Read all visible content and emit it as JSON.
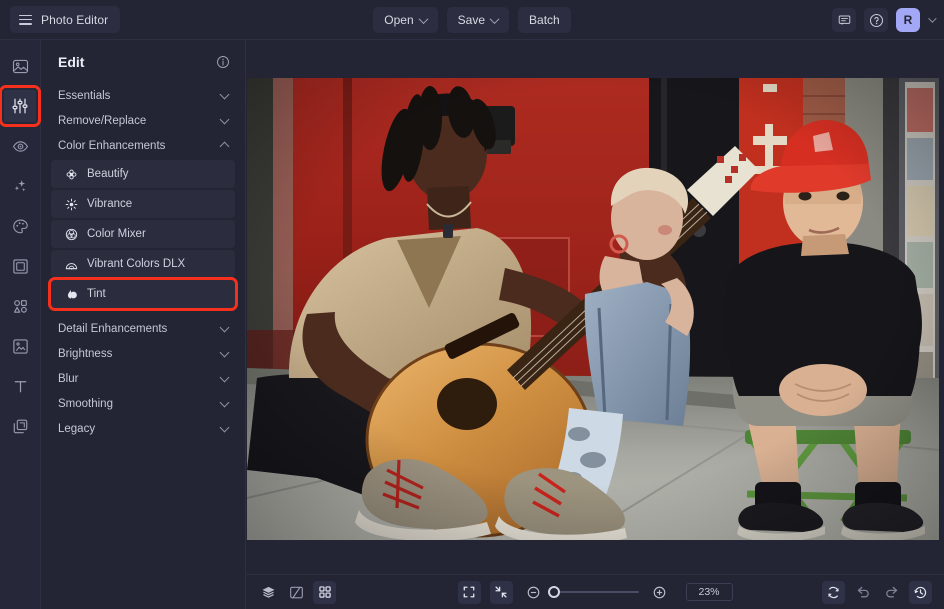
{
  "app": {
    "title": "Photo Editor",
    "menu_icon": "hamburger-icon"
  },
  "topbar": {
    "open_label": "Open",
    "save_label": "Save",
    "batch_label": "Batch",
    "feedback_icon": "comment-icon",
    "help_icon": "help-circle-icon",
    "avatar_initial": "R"
  },
  "rail": {
    "items": [
      {
        "name": "image-tool",
        "icon": "image-icon",
        "active": false,
        "highlighted": false
      },
      {
        "name": "adjust-tool",
        "icon": "sliders-icon",
        "active": true,
        "highlighted": true
      },
      {
        "name": "retouch-tool",
        "icon": "eye-icon",
        "active": false,
        "highlighted": false
      },
      {
        "name": "effects-tool",
        "icon": "sparkles-icon",
        "active": false,
        "highlighted": false
      },
      {
        "name": "paint-tool",
        "icon": "palette-icon",
        "active": false,
        "highlighted": false
      },
      {
        "name": "frame-tool",
        "icon": "frame-icon",
        "active": false,
        "highlighted": false
      },
      {
        "name": "shapes-tool",
        "icon": "shapes-icon",
        "active": false,
        "highlighted": false
      },
      {
        "name": "crop-tool",
        "icon": "crop-frame-icon",
        "active": false,
        "highlighted": false
      },
      {
        "name": "text-tool",
        "icon": "text-icon",
        "active": false,
        "highlighted": false
      },
      {
        "name": "layers-tool",
        "icon": "layers-stack-icon",
        "active": false,
        "highlighted": false
      }
    ]
  },
  "panel": {
    "title": "Edit",
    "info_icon": "info-circle-icon",
    "groups": [
      {
        "label": "Essentials",
        "expanded": false
      },
      {
        "label": "Remove/Replace",
        "expanded": false
      },
      {
        "label": "Color Enhancements",
        "expanded": true
      },
      {
        "label": "Detail Enhancements",
        "expanded": false
      },
      {
        "label": "Brightness",
        "expanded": false
      },
      {
        "label": "Blur",
        "expanded": false
      },
      {
        "label": "Smoothing",
        "expanded": false
      },
      {
        "label": "Legacy",
        "expanded": false
      }
    ],
    "color_enhancement_items": [
      {
        "label": "Beautify",
        "icon": "flower-icon",
        "highlighted": false
      },
      {
        "label": "Vibrance",
        "icon": "sun-burst-icon",
        "highlighted": false
      },
      {
        "label": "Color Mixer",
        "icon": "color-circles-icon",
        "highlighted": false
      },
      {
        "label": "Vibrant Colors DLX",
        "icon": "vibrant-colors-icon",
        "highlighted": false
      },
      {
        "label": "Tint",
        "icon": "tint-drop-icon",
        "highlighted": true
      }
    ]
  },
  "bottombar": {
    "left_tools": [
      {
        "name": "layers-button",
        "icon": "layers-icon",
        "active": false
      },
      {
        "name": "compare-button",
        "icon": "compare-split-icon",
        "active": false
      },
      {
        "name": "grid-button",
        "icon": "grid-four-icon",
        "active": true
      }
    ],
    "center_tools": [
      {
        "name": "fit-to-screen-button",
        "icon": "fit-frame-icon",
        "active": true
      },
      {
        "name": "actual-size-button",
        "icon": "collapse-arrows-icon",
        "active": true
      }
    ],
    "zoom_out_icon": "minus-circle-icon",
    "zoom_in_icon": "plus-circle-icon",
    "zoom_level": "23%",
    "slider_position_percent": 0,
    "right_tools": [
      {
        "name": "reset-button",
        "icon": "refresh-icon",
        "active": true
      },
      {
        "name": "undo-button",
        "icon": "undo-arrow-icon",
        "active": false
      },
      {
        "name": "redo-button",
        "icon": "redo-arrow-icon",
        "active": false
      },
      {
        "name": "history-button",
        "icon": "history-clock-icon",
        "active": true
      }
    ]
  },
  "colors": {
    "highlight": "#f5311d",
    "accent": "#a3a8f6",
    "panel_bg": "#232434",
    "rail_bg": "#262739",
    "item_bg": "#2b2c3e"
  },
  "canvas": {
    "photo_alt": "Three street musicians sitting against a red wall, one playing an acoustic guitar"
  }
}
